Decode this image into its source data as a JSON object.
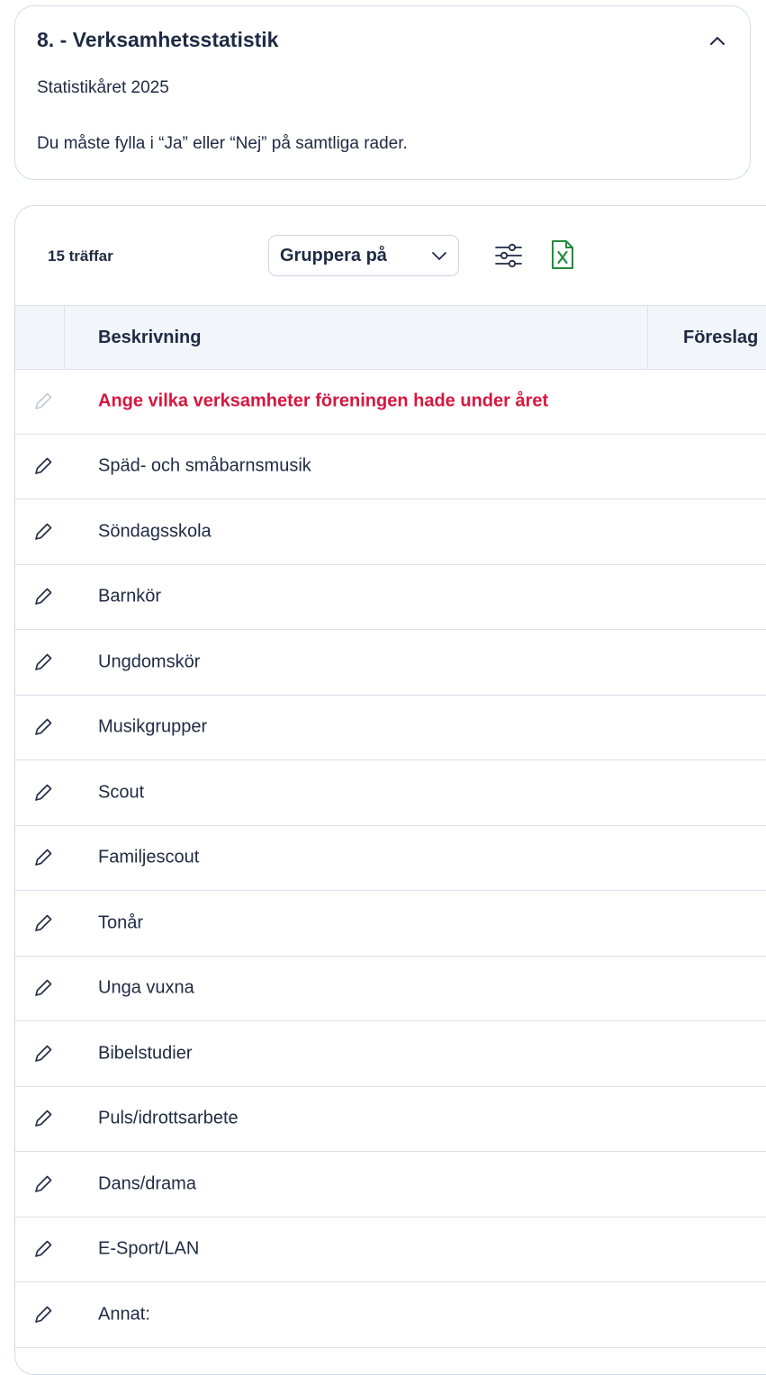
{
  "section": {
    "title": "8. - Verksamhetsstatistik",
    "year_text": "Statistikåret 2025",
    "instruction": "Du måste fylla i “Ja” eller “Nej” på samtliga rader."
  },
  "toolbar": {
    "hit_count": "15 träffar",
    "group_by_label": "Gruppera på"
  },
  "table": {
    "columns": [
      "Beskrivning",
      "Föreslag"
    ],
    "rows": [
      {
        "label": "Ange vilka verksamheter föreningen hade under året",
        "kind": "header"
      },
      {
        "label": "Späd- och småbarnsmusik"
      },
      {
        "label": "Söndagsskola"
      },
      {
        "label": "Barnkör"
      },
      {
        "label": "Ungdomskör"
      },
      {
        "label": "Musikgrupper"
      },
      {
        "label": "Scout"
      },
      {
        "label": "Familjescout"
      },
      {
        "label": "Tonår"
      },
      {
        "label": "Unga vuxna"
      },
      {
        "label": "Bibelstudier"
      },
      {
        "label": "Puls/idrottsarbete"
      },
      {
        "label": "Dans/drama"
      },
      {
        "label": "E-Sport/LAN"
      },
      {
        "label": "Annat:"
      }
    ]
  },
  "icons": {
    "collapse": "chevron-up-icon",
    "dropdown": "chevron-down-icon",
    "filter": "sliders-icon",
    "export": "excel-icon",
    "edit": "pencil-icon"
  },
  "colors": {
    "accent_red": "#d6173f",
    "excel_green": "#1e8e3e",
    "text": "#1f2a44",
    "border": "#d3dbe7",
    "header_bg": "#f2f5f9"
  }
}
